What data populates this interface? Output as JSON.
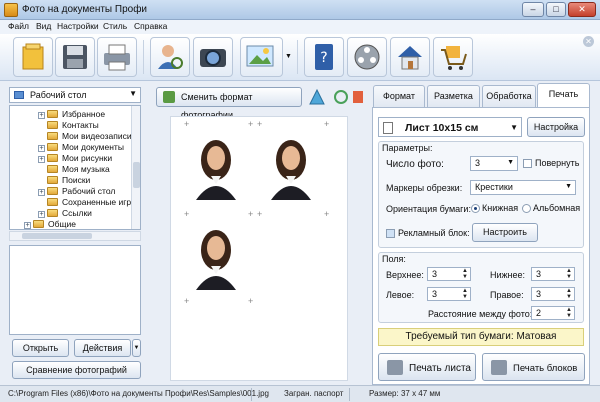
{
  "window": {
    "title": "Фото на документы Профи",
    "min": "–",
    "max": "□",
    "close": "✕"
  },
  "menu": [
    "Файл",
    "Вид",
    "Настройки",
    "Стиль",
    "Справка"
  ],
  "toolbar_icons": [
    "open-folder-icon",
    "save-disk-icon",
    "printer-icon",
    "person-search-icon",
    "camera-icon",
    "image-edit-icon",
    "book-help-icon",
    "film-reel-icon",
    "home-icon",
    "shopping-cart-icon"
  ],
  "left": {
    "location": "Рабочий стол",
    "tree": [
      {
        "label": "Избранное",
        "indent": 1,
        "exp": true
      },
      {
        "label": "Контакты",
        "indent": 1,
        "exp": false
      },
      {
        "label": "Мои видеозаписи",
        "indent": 1,
        "exp": false
      },
      {
        "label": "Мои документы",
        "indent": 1,
        "exp": true
      },
      {
        "label": "Мои рисунки",
        "indent": 1,
        "exp": true
      },
      {
        "label": "Моя музыка",
        "indent": 1,
        "exp": false
      },
      {
        "label": "Поиски",
        "indent": 1,
        "exp": false
      },
      {
        "label": "Рабочий стол",
        "indent": 1,
        "exp": true
      },
      {
        "label": "Сохраненные игры",
        "indent": 1,
        "exp": false
      },
      {
        "label": "Ссылки",
        "indent": 1,
        "exp": true
      },
      {
        "label": "Общие",
        "indent": 0,
        "exp": true
      }
    ],
    "open_btn": "Открыть",
    "actions_btn": "Действия",
    "compare_btn": "Сравнение фотографий"
  },
  "center": {
    "change_format_btn": "Сменить формат фотографии"
  },
  "tabs": [
    "Формат",
    "Разметка",
    "Обработка",
    "Печать"
  ],
  "print": {
    "sheet": "Лист 10x15 см",
    "settings_btn": "Настройка",
    "params_label": "Параметры:",
    "photo_count_label": "Число фото:",
    "photo_count": "3",
    "rotate_label": "Повернуть",
    "markers_label": "Маркеры обрезки:",
    "markers_value": "Крестики",
    "orientation_label": "Ориентация бумаги:",
    "portrait": "Книжная",
    "landscape": "Альбомная",
    "ad_block_label": "Рекламный блок:",
    "configure_btn": "Настроить",
    "margins_label": "Поля:",
    "top_label": "Верхнее:",
    "top": "3",
    "bottom_label": "Нижнее:",
    "bottom": "3",
    "left_label": "Левое:",
    "left": "3",
    "right_label": "Правое:",
    "right": "3",
    "spacing_label": "Расстояние между фото:",
    "spacing": "2",
    "paper_notice": "Требуемый тип бумаги: Матовая",
    "print_sheet_btn": "Печать листа",
    "print_blocks_btn": "Печать блоков"
  },
  "status": {
    "path": "C:\\Program Files (x86)\\Фото на документы Профи\\Res\\Samples\\001.jpg",
    "doc": "Загран. паспорт",
    "size": "Размер: 37 x 47 мм"
  }
}
